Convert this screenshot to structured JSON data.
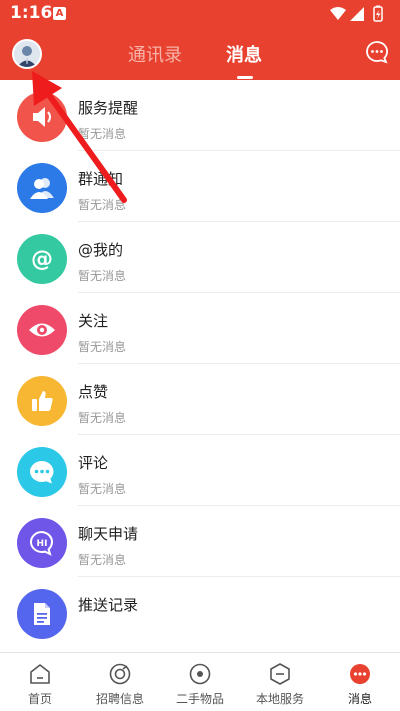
{
  "status": {
    "time": "1:16",
    "notif_letter": "A"
  },
  "header": {
    "tabs": [
      {
        "label": "通讯录",
        "active": false
      },
      {
        "label": "消息",
        "active": true
      }
    ]
  },
  "messages": [
    {
      "title": "服务提醒",
      "subtitle": "暂无消息",
      "icon": "speaker-icon",
      "color": "#f0544a"
    },
    {
      "title": "群通知",
      "subtitle": "暂无消息",
      "icon": "group-icon",
      "color": "#2b7ae7"
    },
    {
      "title": "@我的",
      "subtitle": "暂无消息",
      "icon": "at-icon",
      "color": "#34c9a0"
    },
    {
      "title": "关注",
      "subtitle": "暂无消息",
      "icon": "eye-icon",
      "color": "#ef4a6a"
    },
    {
      "title": "点赞",
      "subtitle": "暂无消息",
      "icon": "thumbs-up-icon",
      "color": "#f7b733"
    },
    {
      "title": "评论",
      "subtitle": "暂无消息",
      "icon": "comment-icon",
      "color": "#2bc8e7"
    },
    {
      "title": "聊天申请",
      "subtitle": "暂无消息",
      "icon": "hi-bubble-icon",
      "color": "#6f55e8"
    },
    {
      "title": "推送记录",
      "subtitle": "",
      "icon": "document-icon",
      "color": "#5566ee"
    }
  ],
  "bottom_nav": [
    {
      "label": "首页",
      "icon": "home-icon"
    },
    {
      "label": "招聘信息",
      "icon": "recruit-icon"
    },
    {
      "label": "二手物品",
      "icon": "secondhand-icon"
    },
    {
      "label": "本地服务",
      "icon": "local-service-icon"
    },
    {
      "label": "消息",
      "icon": "messages-icon",
      "active": true
    }
  ]
}
